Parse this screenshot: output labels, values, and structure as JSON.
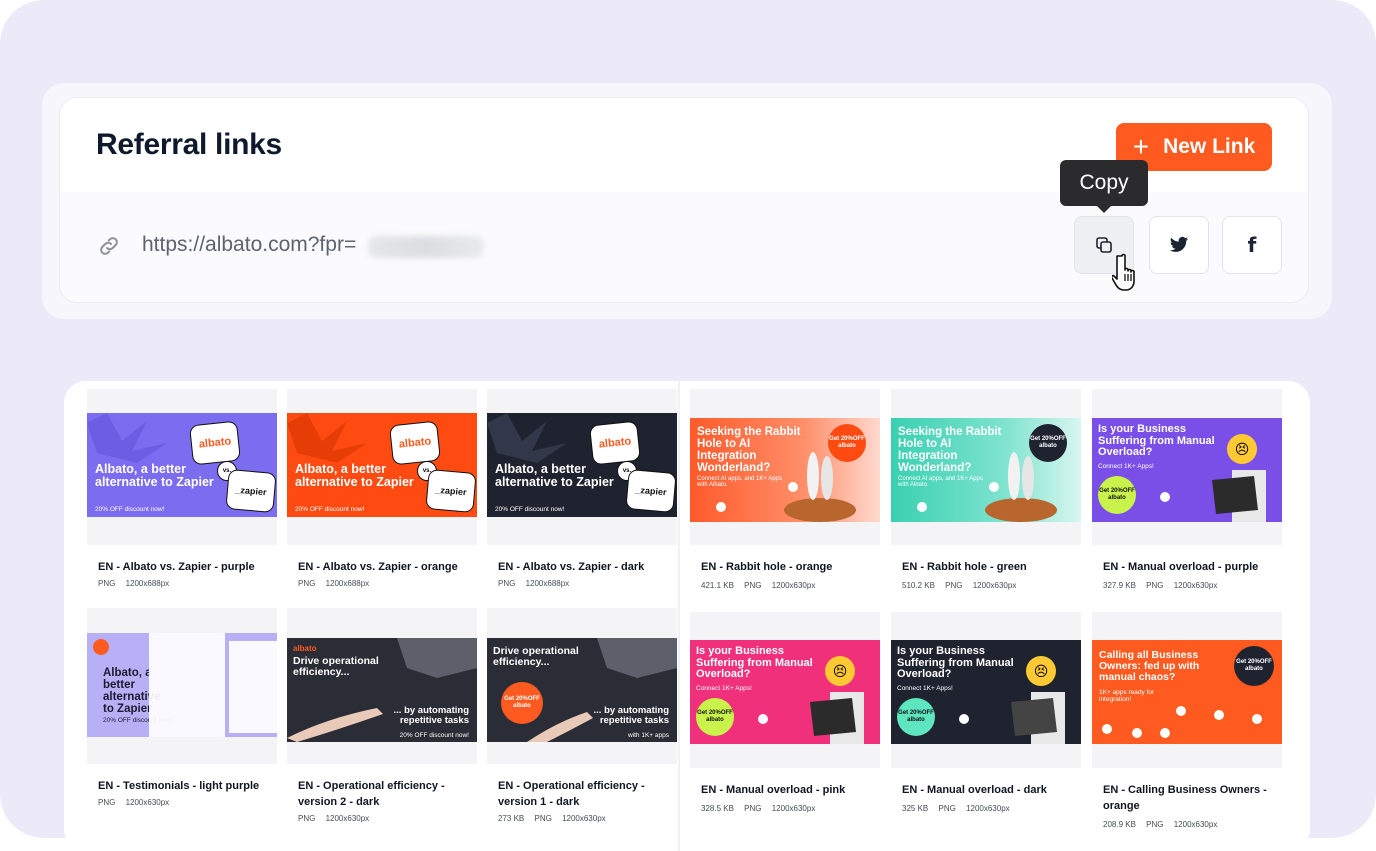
{
  "referral": {
    "title": "Referral links",
    "new_link_label": "New Link",
    "url_visible": "https://albato.com?fpr=",
    "tooltip": "Copy"
  },
  "icons": {
    "plus": "+",
    "twitter": "twitter-icon",
    "facebook": "f"
  },
  "colors": {
    "accent": "#ff5a1f",
    "page_bg": "#eceaf8"
  },
  "cards": [
    {
      "name": "EN - Albato vs. Zapier - purple",
      "format": "PNG",
      "dims": "1200x688px",
      "size": "",
      "banner": {
        "title": "Albato, a better alternative to Zapier",
        "sub": "20% OFF discount now!",
        "logo1": "albato",
        "vs": "vs.",
        "logo2": "_zapier"
      }
    },
    {
      "name": "EN - Albato vs. Zapier - orange",
      "format": "PNG",
      "dims": "1200x688px",
      "size": "",
      "banner": {
        "title": "Albato, a better alternative to Zapier",
        "sub": "20% OFF discount now!",
        "logo1": "albato",
        "vs": "vs.",
        "logo2": "_zapier"
      }
    },
    {
      "name": "EN - Albato vs. Zapier - dark",
      "format": "PNG",
      "dims": "1200x688px",
      "size": "",
      "banner": {
        "title": "Albato, a better alternative to Zapier",
        "sub": "20% OFF discount now!",
        "logo1": "albato",
        "vs": "vs.",
        "logo2": "_zapier"
      }
    },
    {
      "name": "EN - Rabbit hole - orange",
      "format": "PNG",
      "dims": "1200x630px",
      "size": "421.1 KB",
      "banner": {
        "title": "Seeking the Rabbit Hole to AI Integration Wonderland?",
        "sub": "Connect AI apps, and 1K+ Apps with Albato.",
        "badge": "Get 20%OFF albato"
      }
    },
    {
      "name": "EN - Rabbit hole - green",
      "format": "PNG",
      "dims": "1200x630px",
      "size": "510.2 KB",
      "banner": {
        "title": "Seeking the Rabbit Hole to AI Integration Wonderland?",
        "sub": "Connect AI apps, and 1K+ Apps with Albato.",
        "badge": "Get 20%OFF albato"
      }
    },
    {
      "name": "EN - Manual overload - purple",
      "format": "PNG",
      "dims": "1200x630px",
      "size": "327.9 KB",
      "banner": {
        "title": "Is your Business Suffering from Manual Overload?",
        "sub": "Connect 1K+ Apps!",
        "badge": "Get 20%OFF albato"
      }
    },
    {
      "name": "EN - Testimonials - light purple",
      "format": "PNG",
      "dims": "1200x630px",
      "size": "",
      "banner": {
        "title": "Albato, a better alternative to Zapier",
        "sub": "20% OFF discount now!"
      }
    },
    {
      "name": "EN - Operational efficiency - version 2 - dark",
      "format": "PNG",
      "dims": "1200x630px",
      "size": "",
      "banner": {
        "brand": "albato",
        "title": "Drive operational efficiency...",
        "title2": "... by automating repetitive tasks",
        "sub": "20% OFF discount now!"
      }
    },
    {
      "name": "EN - Operational efficiency - version 1 - dark",
      "format": "PNG",
      "dims": "1200x630px",
      "size": "273 KB",
      "banner": {
        "title": "Drive operational efficiency...",
        "title2": "... by automating repetitive tasks",
        "sub": "with 1K+ apps",
        "badge": "Get 20%OFF albato"
      }
    },
    {
      "name": "EN - Manual overload - pink",
      "format": "PNG",
      "dims": "1200x630px",
      "size": "328.5 KB",
      "banner": {
        "title": "Is your Business Suffering from Manual Overload?",
        "sub": "Connect 1K+ Apps!",
        "badge": "Get 20%OFF albato"
      }
    },
    {
      "name": "EN - Manual overload - dark",
      "format": "PNG",
      "dims": "1200x630px",
      "size": "325 KB",
      "banner": {
        "title": "Is your Business Suffering from Manual Overload?",
        "sub": "Connect 1K+ Apps!",
        "badge": "Get 20%OFF albato"
      }
    },
    {
      "name": "EN - Calling Business Owners - orange",
      "format": "PNG",
      "dims": "1200x630px",
      "size": "208.9 KB",
      "banner": {
        "title": "Calling all Business Owners: fed up with manual chaos?",
        "sub": "1K+ apps ready for integration!",
        "badge": "Get 20%OFF albato"
      }
    }
  ]
}
